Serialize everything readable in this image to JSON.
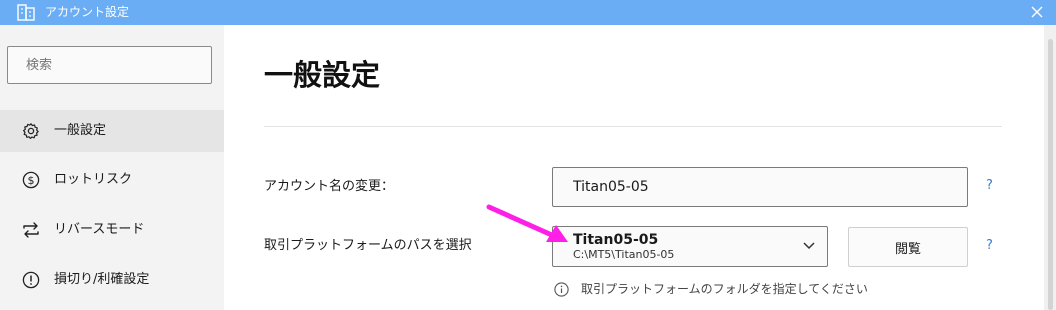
{
  "window": {
    "title": "アカウント設定"
  },
  "search": {
    "placeholder": "検索"
  },
  "sidebar": {
    "items": [
      {
        "label": "一般設定",
        "icon": "gear-icon",
        "active": true
      },
      {
        "label": "ロットリスク",
        "icon": "dollar-circle-icon",
        "active": false
      },
      {
        "label": "リバースモード",
        "icon": "swap-arrows-icon",
        "active": false
      },
      {
        "label": "損切り/利確設定",
        "icon": "exclamation-circle-icon",
        "active": false
      }
    ]
  },
  "main": {
    "title": "一般設定",
    "account_name": {
      "label": "アカウント名の変更：",
      "value": "Titan05-05",
      "help": "?"
    },
    "platform": {
      "label": "取引プラットフォームのパスを選択",
      "selected_name": "Titan05-05",
      "selected_path": "C:\\MT5\\Titan05-05",
      "browse_label": "閲覧",
      "help": "?",
      "hint": "取引プラットフォームのフォルダを指定してください"
    }
  },
  "colors": {
    "titlebar": "#6aadf4",
    "sidebar_bg": "#f3f3f3",
    "active_item_bg": "#e5e5e5",
    "help_link": "#3a7bd5",
    "annotation_arrow": "#ff1fe6"
  }
}
